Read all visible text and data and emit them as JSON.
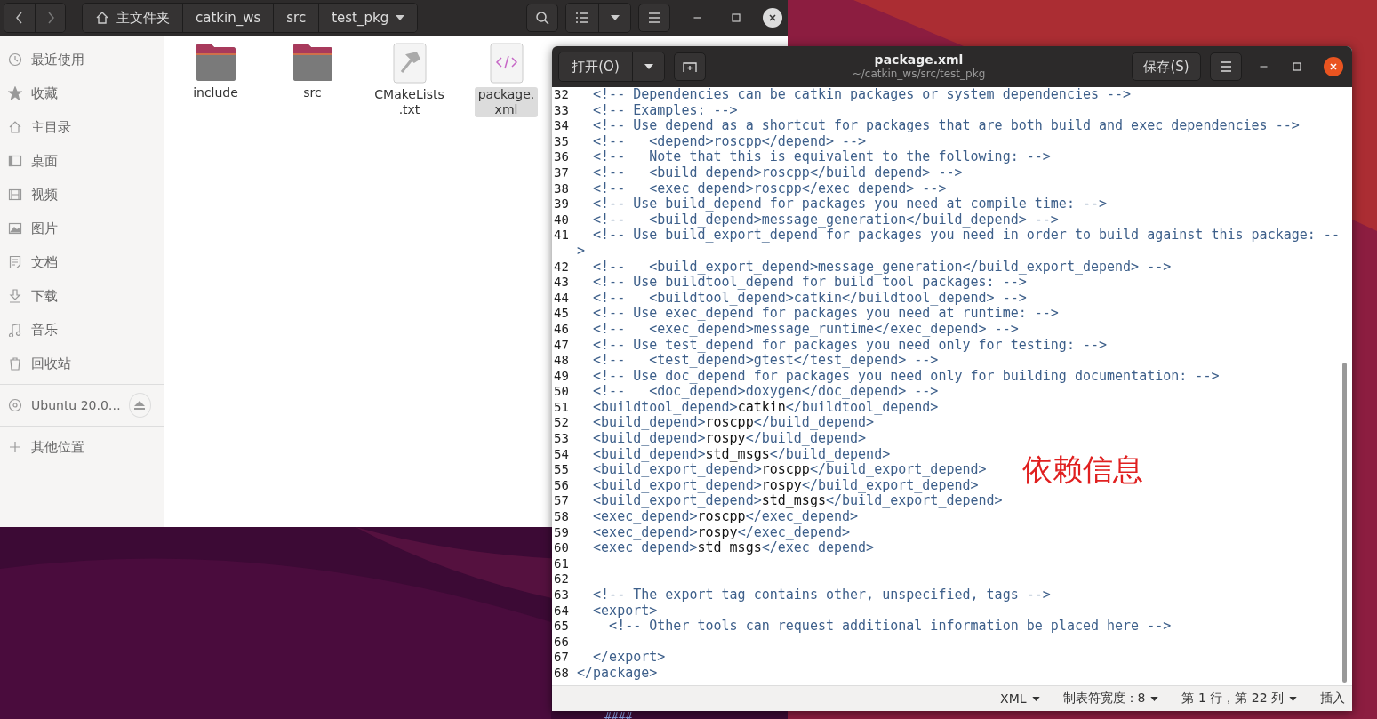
{
  "file_manager": {
    "path": [
      "主文件夹",
      "catkin_ws",
      "src",
      "test_pkg"
    ],
    "sidebar": {
      "places": [
        {
          "label": "最近使用"
        },
        {
          "label": "收藏"
        },
        {
          "label": "主目录"
        },
        {
          "label": "桌面"
        },
        {
          "label": "视频"
        },
        {
          "label": "图片"
        },
        {
          "label": "文档"
        },
        {
          "label": "下载"
        },
        {
          "label": "音乐"
        },
        {
          "label": "回收站"
        }
      ],
      "devices": [
        {
          "label": "Ubuntu 20.0…"
        }
      ],
      "other": {
        "label": "其他位置"
      }
    },
    "files": [
      {
        "name": "include",
        "kind": "folder",
        "selected": false
      },
      {
        "name": "src",
        "kind": "folder",
        "selected": false
      },
      {
        "name": "CMakeLists\n.txt",
        "kind": "script",
        "selected": false
      },
      {
        "name": "package.\nxml",
        "kind": "code",
        "selected": true
      }
    ]
  },
  "editor": {
    "open_button": "打开(O)",
    "title": "package.xml",
    "subtitle": "~/catkin_ws/src/test_pkg",
    "save_button": "保存(S)",
    "lines": [
      {
        "n": "32",
        "parts": [
          {
            "kind": "markup",
            "text": "  <!-- Dependencies can be catkin packages or system dependencies -->"
          }
        ]
      },
      {
        "n": "33",
        "parts": [
          {
            "kind": "markup",
            "text": "  <!-- Examples: -->"
          }
        ]
      },
      {
        "n": "34",
        "parts": [
          {
            "kind": "markup",
            "text": "  <!-- Use depend as a shortcut for packages that are both build and exec dependencies -->"
          }
        ]
      },
      {
        "n": "35",
        "parts": [
          {
            "kind": "markup",
            "text": "  <!--   <depend>roscpp</depend> -->"
          }
        ]
      },
      {
        "n": "36",
        "parts": [
          {
            "kind": "markup",
            "text": "  <!--   Note that this is equivalent to the following: -->"
          }
        ]
      },
      {
        "n": "37",
        "parts": [
          {
            "kind": "markup",
            "text": "  <!--   <build_depend>roscpp</build_depend> -->"
          }
        ]
      },
      {
        "n": "38",
        "parts": [
          {
            "kind": "markup",
            "text": "  <!--   <exec_depend>roscpp</exec_depend> -->"
          }
        ]
      },
      {
        "n": "39",
        "parts": [
          {
            "kind": "markup",
            "text": "  <!-- Use build_depend for packages you need at compile time: -->"
          }
        ]
      },
      {
        "n": "40",
        "parts": [
          {
            "kind": "markup",
            "text": "  <!--   <build_depend>message_generation</build_depend> -->"
          }
        ]
      },
      {
        "n": "41",
        "parts": [
          {
            "kind": "markup",
            "text": "  <!-- Use build_export_depend for packages you need in order to build against this package: --"
          }
        ],
        "continuation": ">"
      },
      {
        "n": "42",
        "parts": [
          {
            "kind": "markup",
            "text": "  <!--   <build_export_depend>message_generation</build_export_depend> -->"
          }
        ]
      },
      {
        "n": "43",
        "parts": [
          {
            "kind": "markup",
            "text": "  <!-- Use buildtool_depend for build tool packages: -->"
          }
        ]
      },
      {
        "n": "44",
        "parts": [
          {
            "kind": "markup",
            "text": "  <!--   <buildtool_depend>catkin</buildtool_depend> -->"
          }
        ]
      },
      {
        "n": "45",
        "parts": [
          {
            "kind": "markup",
            "text": "  <!-- Use exec_depend for packages you need at runtime: -->"
          }
        ]
      },
      {
        "n": "46",
        "parts": [
          {
            "kind": "markup",
            "text": "  <!--   <exec_depend>message_runtime</exec_depend> -->"
          }
        ]
      },
      {
        "n": "47",
        "parts": [
          {
            "kind": "markup",
            "text": "  <!-- Use test_depend for packages you need only for testing: -->"
          }
        ]
      },
      {
        "n": "48",
        "parts": [
          {
            "kind": "markup",
            "text": "  <!--   <test_depend>gtest</test_depend> -->"
          }
        ]
      },
      {
        "n": "49",
        "parts": [
          {
            "kind": "markup",
            "text": "  <!-- Use doc_depend for packages you need only for building documentation: -->"
          }
        ]
      },
      {
        "n": "50",
        "parts": [
          {
            "kind": "markup",
            "text": "  <!--   <doc_depend>doxygen</doc_depend> -->"
          }
        ]
      },
      {
        "n": "51",
        "parts": [
          {
            "kind": "markup",
            "text": "  <buildtool_depend>"
          },
          {
            "kind": "content",
            "text": "catkin"
          },
          {
            "kind": "markup",
            "text": "</buildtool_depend>"
          }
        ]
      },
      {
        "n": "52",
        "parts": [
          {
            "kind": "markup",
            "text": "  <build_depend>"
          },
          {
            "kind": "content",
            "text": "roscpp"
          },
          {
            "kind": "markup",
            "text": "</build_depend>"
          }
        ]
      },
      {
        "n": "53",
        "parts": [
          {
            "kind": "markup",
            "text": "  <build_depend>"
          },
          {
            "kind": "content",
            "text": "rospy"
          },
          {
            "kind": "markup",
            "text": "</build_depend>"
          }
        ]
      },
      {
        "n": "54",
        "parts": [
          {
            "kind": "markup",
            "text": "  <build_depend>"
          },
          {
            "kind": "content",
            "text": "std_msgs"
          },
          {
            "kind": "markup",
            "text": "</build_depend>"
          }
        ]
      },
      {
        "n": "55",
        "parts": [
          {
            "kind": "markup",
            "text": "  <build_export_depend>"
          },
          {
            "kind": "content",
            "text": "roscpp"
          },
          {
            "kind": "markup",
            "text": "</build_export_depend>"
          }
        ]
      },
      {
        "n": "56",
        "parts": [
          {
            "kind": "markup",
            "text": "  <build_export_depend>"
          },
          {
            "kind": "content",
            "text": "rospy"
          },
          {
            "kind": "markup",
            "text": "</build_export_depend>"
          }
        ]
      },
      {
        "n": "57",
        "parts": [
          {
            "kind": "markup",
            "text": "  <build_export_depend>"
          },
          {
            "kind": "content",
            "text": "std_msgs"
          },
          {
            "kind": "markup",
            "text": "</build_export_depend>"
          }
        ]
      },
      {
        "n": "58",
        "parts": [
          {
            "kind": "markup",
            "text": "  <exec_depend>"
          },
          {
            "kind": "content",
            "text": "roscpp"
          },
          {
            "kind": "markup",
            "text": "</exec_depend>"
          }
        ]
      },
      {
        "n": "59",
        "parts": [
          {
            "kind": "markup",
            "text": "  <exec_depend>"
          },
          {
            "kind": "content",
            "text": "rospy"
          },
          {
            "kind": "markup",
            "text": "</exec_depend>"
          }
        ]
      },
      {
        "n": "60",
        "parts": [
          {
            "kind": "markup",
            "text": "  <exec_depend>"
          },
          {
            "kind": "content",
            "text": "std_msgs"
          },
          {
            "kind": "markup",
            "text": "</exec_depend>"
          }
        ]
      },
      {
        "n": "61"
      },
      {
        "n": "62"
      },
      {
        "n": "63",
        "parts": [
          {
            "kind": "markup",
            "text": "  <!-- The export tag contains other, unspecified, tags -->"
          }
        ]
      },
      {
        "n": "64",
        "parts": [
          {
            "kind": "markup",
            "text": "  <export>"
          }
        ]
      },
      {
        "n": "65",
        "parts": [
          {
            "kind": "markup",
            "text": "    <!-- Other tools can request additional information be placed here -->"
          }
        ]
      },
      {
        "n": "66"
      },
      {
        "n": "67",
        "parts": [
          {
            "kind": "markup",
            "text": "  </export>"
          }
        ]
      },
      {
        "n": "68",
        "parts": [
          {
            "kind": "markup",
            "text": "</package>"
          }
        ]
      }
    ],
    "annotation": "依赖信息",
    "status_bar": {
      "language": "XML",
      "tab_width": "制表符宽度：8",
      "position": "第 1 行，第 22 列",
      "mode": "插入"
    }
  },
  "desktop_text": "####"
}
